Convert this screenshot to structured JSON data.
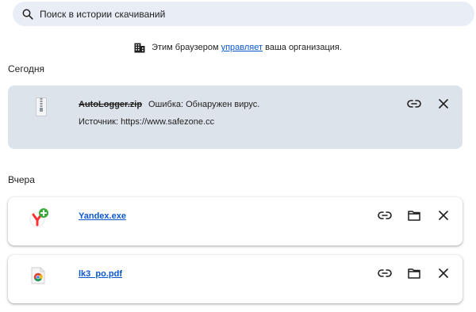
{
  "search": {
    "placeholder": "Поиск в истории скачиваний",
    "icon": "search-icon"
  },
  "managed": {
    "prefix": "Этим браузером ",
    "link": "управляет",
    "suffix": " ваша организация.",
    "icon": "building-icon"
  },
  "sections": {
    "today": "Сегодня",
    "yesterday": "Вчера"
  },
  "downloads": {
    "today": {
      "filename": "AutoLogger.zip",
      "status": "Ошибка: Обнаружен вирус.",
      "source": "Источник: https://www.safezone.cc"
    },
    "yesterday": [
      {
        "filename": "Yandex.exe",
        "icon": "yandex-browser-icon"
      },
      {
        "filename": "lk3_po.pdf",
        "icon": "chrome-document-icon"
      }
    ]
  },
  "colors": {
    "accent": "#0b57d0",
    "danger_card_bg": "#dde3ea",
    "search_bg": "#e9eef6"
  }
}
